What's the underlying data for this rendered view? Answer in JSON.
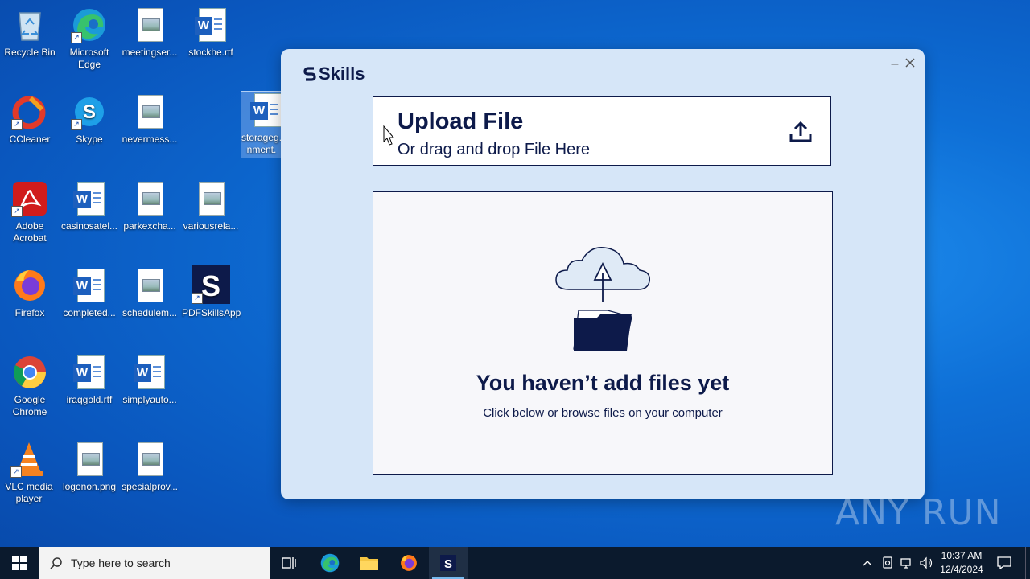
{
  "desktop": {
    "icons": [
      {
        "label": "Recycle Bin",
        "icon": "recycle-bin-icon"
      },
      {
        "label": "Microsoft Edge",
        "icon": "edge-icon"
      },
      {
        "label": "meetingser...",
        "icon": "image-file-icon"
      },
      {
        "label": "stockhe.rtf",
        "icon": "word-document-icon"
      },
      {
        "label": "CCleaner",
        "icon": "ccleaner-icon"
      },
      {
        "label": "Skype",
        "icon": "skype-icon"
      },
      {
        "label": "nevermess...",
        "icon": "image-file-icon"
      },
      {
        "label": "storageg... nment.",
        "icon": "word-document-icon"
      },
      {
        "label": "Adobe Acrobat",
        "icon": "acrobat-icon"
      },
      {
        "label": "casinosatel...",
        "icon": "word-document-icon"
      },
      {
        "label": "parkexcha...",
        "icon": "image-file-icon"
      },
      {
        "label": "variousrela...",
        "icon": "image-file-icon"
      },
      {
        "label": "Firefox",
        "icon": "firefox-icon"
      },
      {
        "label": "completed...",
        "icon": "word-document-icon"
      },
      {
        "label": "schedulem...",
        "icon": "image-file-icon"
      },
      {
        "label": "PDFSkillsApp",
        "icon": "pdfskills-icon"
      },
      {
        "label": "Google Chrome",
        "icon": "chrome-icon"
      },
      {
        "label": "iraqgold.rtf",
        "icon": "word-document-icon"
      },
      {
        "label": "simplyauto...",
        "icon": "word-document-icon"
      },
      {
        "label": "VLC media player",
        "icon": "vlc-icon"
      },
      {
        "label": "logonon.png",
        "icon": "image-file-icon"
      },
      {
        "label": "specialprov...",
        "icon": "image-file-icon"
      }
    ]
  },
  "app": {
    "logo_text": "Skills",
    "upload_title": "Upload File",
    "upload_subtitle": "Or drag and drop File Here",
    "empty_title": "You haven’t add files yet",
    "empty_subtitle": "Click below or browse files on your computer"
  },
  "watermark": "ANY RUN",
  "taskbar": {
    "search_placeholder": "Type here to search",
    "time": "10:37 AM",
    "date": "12/4/2024"
  },
  "colors": {
    "app_bg": "#d6e6f8",
    "brand_navy": "#0d1a4a",
    "taskbar": "#0b1a2d"
  }
}
